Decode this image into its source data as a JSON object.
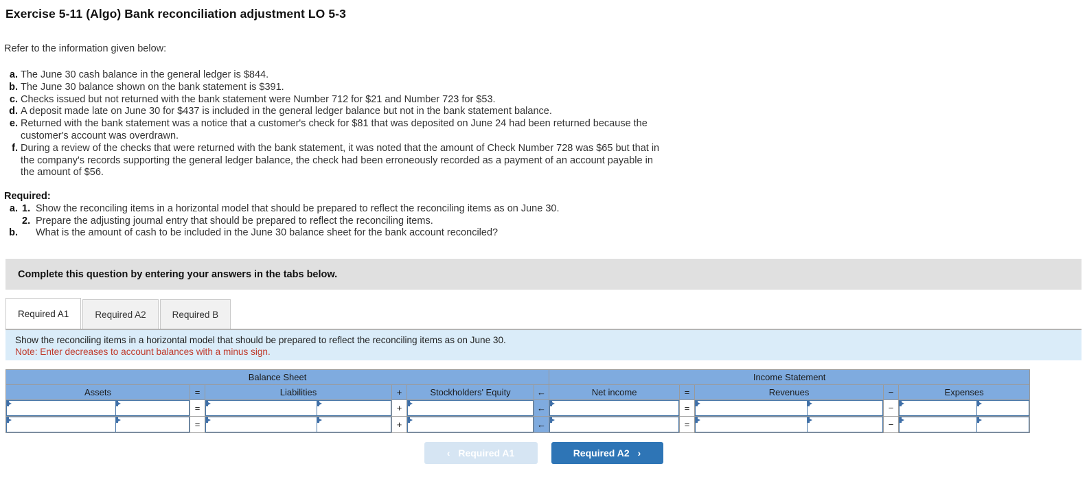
{
  "title": "Exercise 5-11 (Algo) Bank reconciliation adjustment LO 5-3",
  "refer": "Refer to the information given below:",
  "facts": [
    {
      "label": "a.",
      "text": "The June 30 cash balance in the general ledger is $844."
    },
    {
      "label": "b.",
      "text": "The June 30 balance shown on the bank statement is $391."
    },
    {
      "label": "c.",
      "text": "Checks issued but not returned with the bank statement were Number 712 for $21 and Number 723 for $53."
    },
    {
      "label": "d.",
      "text": "A deposit made late on June 30 for $437 is included in the general ledger balance but not in the bank statement balance."
    },
    {
      "label": "e.",
      "text": "Returned with the bank statement was a notice that a customer's check for $81 that was deposited on June 24 had been returned because the customer's account was overdrawn."
    },
    {
      "label": "f.",
      "text": "During a review of the checks that were returned with the bank statement, it was noted that the amount of Check Number 728 was $65 but that in the company's records supporting the general ledger balance, the check had been erroneously recorded as a payment of an account payable in the amount of $56."
    }
  ],
  "required": {
    "heading": "Required:",
    "items": [
      {
        "alpha": "a.",
        "num": "1.",
        "text": "Show the reconciling items in a horizontal model that should be prepared to reflect the reconciling items as on June 30."
      },
      {
        "alpha": "",
        "num": "2.",
        "text": "Prepare the adjusting journal entry that should be prepared to reflect the reconciling items."
      },
      {
        "alpha": "b.",
        "num": "",
        "text": "What is the amount of cash to be included in the June 30 balance sheet for the bank account reconciled?"
      }
    ]
  },
  "banner": {
    "text": "Complete this question by entering your answers in the tabs below."
  },
  "tabs": [
    {
      "label": "Required A1",
      "active": true
    },
    {
      "label": "Required A2",
      "active": false
    },
    {
      "label": "Required B",
      "active": false
    }
  ],
  "note": {
    "line1": "Show the reconciling items in a horizontal model that should be prepared to reflect the reconciling items as on June 30.",
    "line2": "Note: Enter decreases to account balances with a minus sign.",
    "line2_color": "#c0392b",
    "panel_color": "#daecf9"
  },
  "sheet": {
    "groups": [
      {
        "label": "Balance Sheet"
      },
      {
        "label": "Income Statement"
      }
    ],
    "columns": [
      {
        "label": "Assets"
      },
      {
        "label": "=",
        "op": true
      },
      {
        "label": "Liabilities"
      },
      {
        "label": "+",
        "op": true
      },
      {
        "label": "Stockholders' Equity"
      },
      {
        "label": "←",
        "op": true
      },
      {
        "label": "Net income"
      },
      {
        "label": "=",
        "op": true
      },
      {
        "label": "Revenues"
      },
      {
        "label": "−",
        "op": true
      },
      {
        "label": "Expenses"
      }
    ],
    "rows": [
      {
        "assets": [
          "",
          ""
        ],
        "op1": "=",
        "liabilities": [
          "",
          ""
        ],
        "op2": "+",
        "equity": [
          ""
        ],
        "op3": "←",
        "net_income": [
          ""
        ],
        "op4": "=",
        "revenues": [
          "",
          ""
        ],
        "op5": "−",
        "expenses": [
          "",
          ""
        ]
      },
      {
        "assets": [
          "",
          ""
        ],
        "op1": "=",
        "liabilities": [
          "",
          ""
        ],
        "op2": "+",
        "equity": [
          ""
        ],
        "op3": "←",
        "net_income": [
          ""
        ],
        "op4": "=",
        "revenues": [
          "",
          ""
        ],
        "op5": "−",
        "expenses": [
          "",
          ""
        ]
      }
    ],
    "header_color": "#7fabdf"
  },
  "nav": {
    "prev_label": "Required A1",
    "next_label": "Required A2",
    "prev_chevron": "‹",
    "next_chevron": "›",
    "next_color": "#2e75b6",
    "prev_color": "#d6e5f3"
  }
}
